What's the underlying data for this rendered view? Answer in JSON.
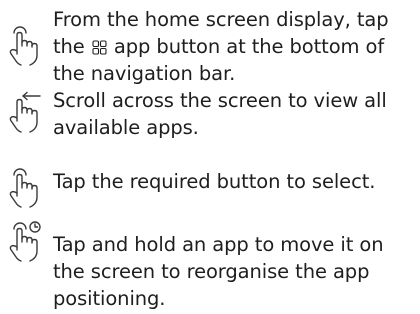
{
  "instructions": [
    {
      "icon": "tap-gesture-icon",
      "text_before": "From the home screen display, tap the ",
      "inline_icon": "apps-grid-icon",
      "text_after": " app button at the bottom of the navigation bar."
    },
    {
      "icon": "swipe-gesture-icon",
      "text": "Scroll across the screen to view all available apps."
    },
    {
      "icon": "tap-gesture-icon",
      "text": "Tap the required button to select."
    },
    {
      "icon": "tap-and-hold-gesture-icon",
      "text": "Tap and hold an app to move it on the screen to reorganise the app positioning."
    }
  ],
  "colors": {
    "text": "#1e1e1e",
    "icon_stroke": "#3a3a3a"
  }
}
